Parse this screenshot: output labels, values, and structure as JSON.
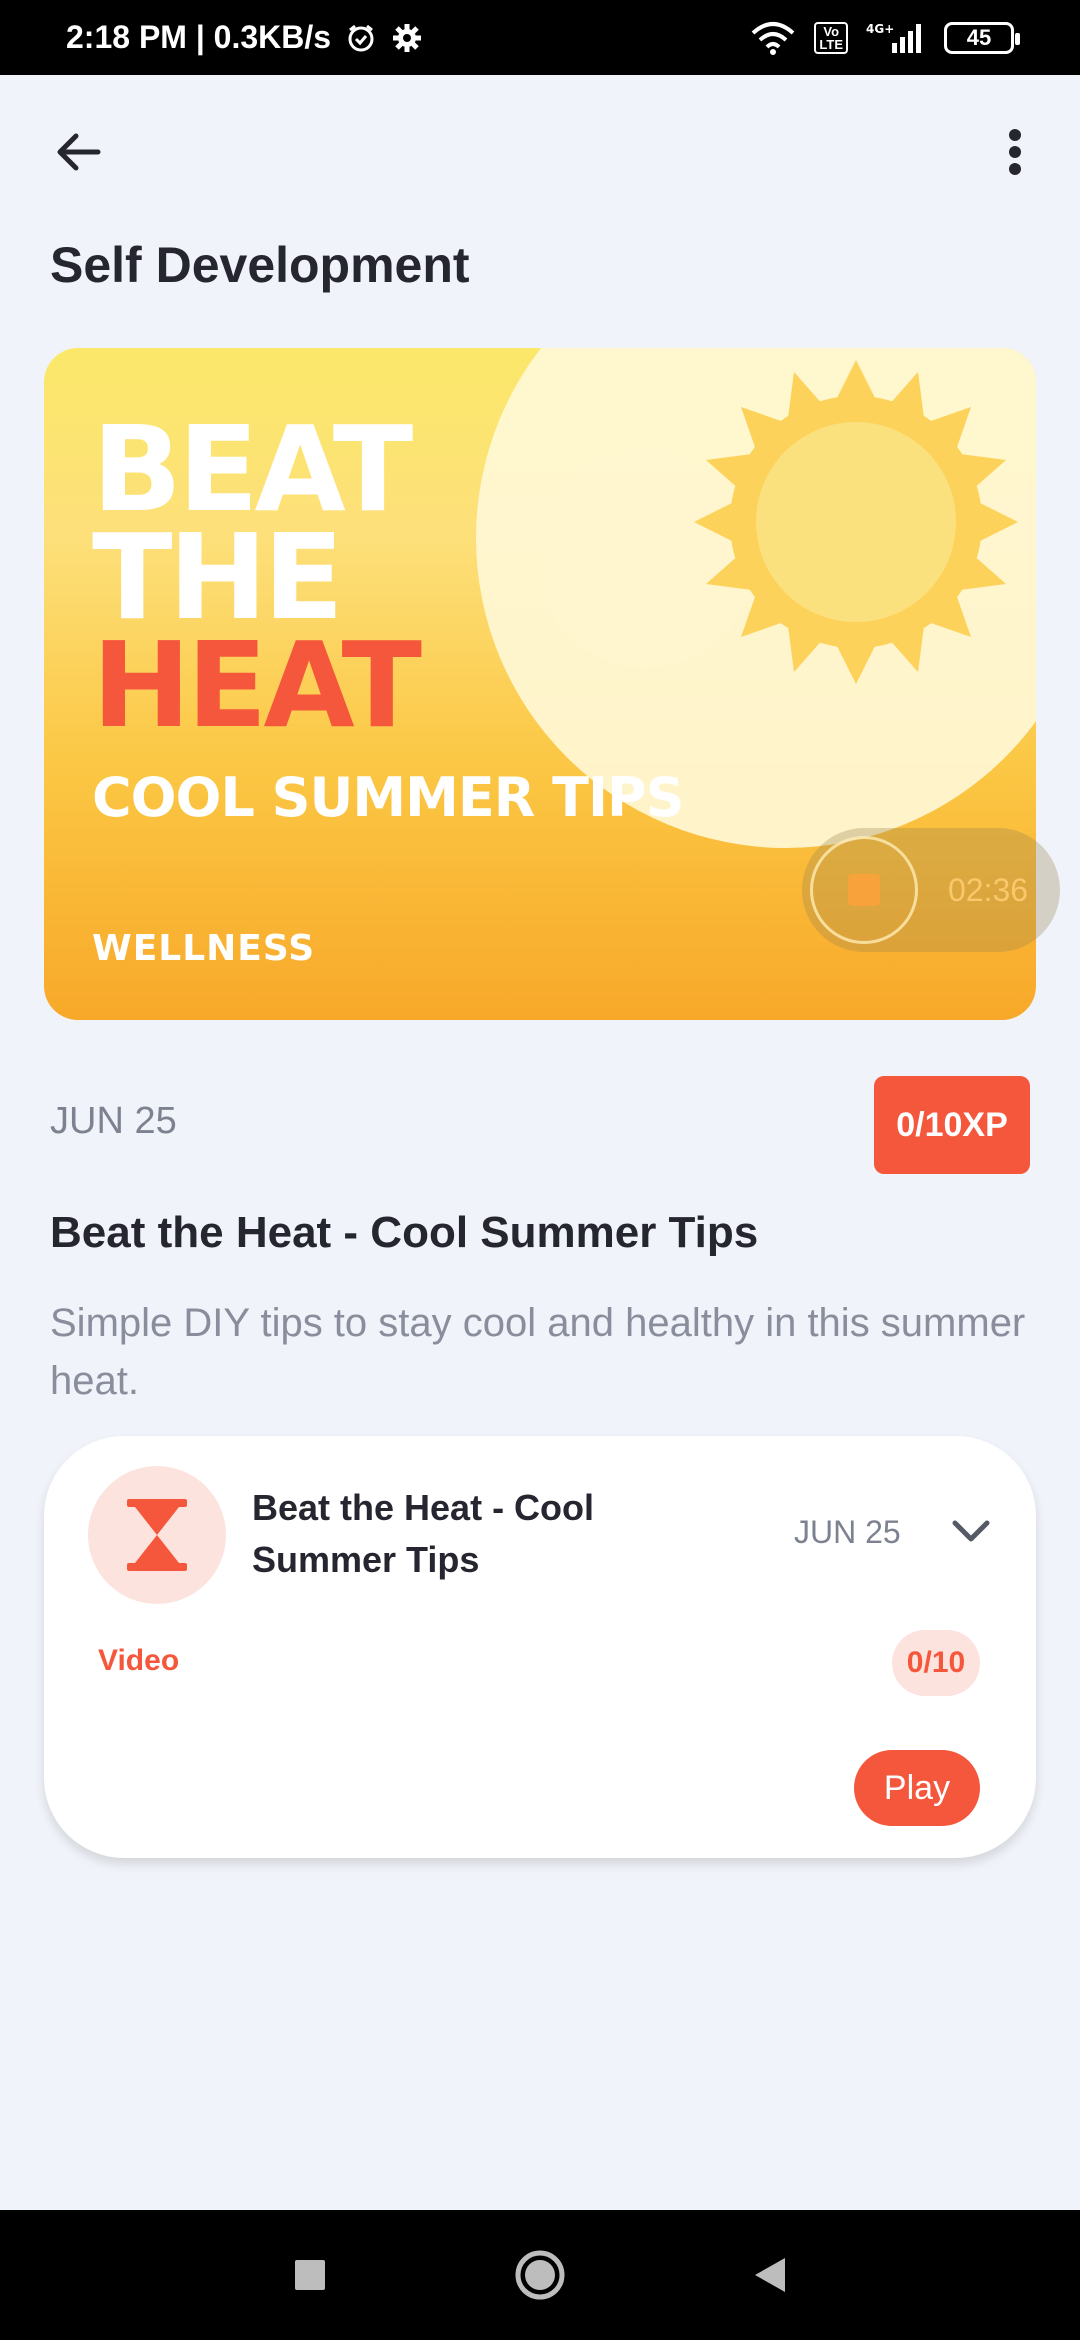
{
  "status_bar": {
    "time_speed": "2:18 PM | 0.3KB/s",
    "network": "4G+",
    "volte": "Vo\nLTE",
    "battery": "45"
  },
  "header": {
    "title": "Self Development"
  },
  "banner": {
    "line1": "BEAT",
    "line2": "THE",
    "line3": "HEAT",
    "subtitle": "COOL SUMMER TIPS",
    "category": "WELLNESS",
    "audio_time": "02:36"
  },
  "meta": {
    "date": "JUN 25",
    "xp": "0/10XP"
  },
  "content": {
    "title": "Beat the Heat - Cool Summer Tips",
    "description": "Simple DIY tips to stay cool and healthy in this summer heat."
  },
  "card": {
    "title": "Beat the Heat - Cool Summer Tips",
    "date": "JUN 25",
    "type": "Video",
    "score": "0/10",
    "play_label": "Play"
  },
  "colors": {
    "accent": "#f5573c",
    "background": "#f0f3f9",
    "banner_top": "#fbe86a",
    "banner_bottom": "#f8a829"
  },
  "icons": {
    "back": "arrow-left-icon",
    "menu": "more-vert-icon",
    "card": "hourglass-icon",
    "chevron": "chevron-down-icon"
  }
}
